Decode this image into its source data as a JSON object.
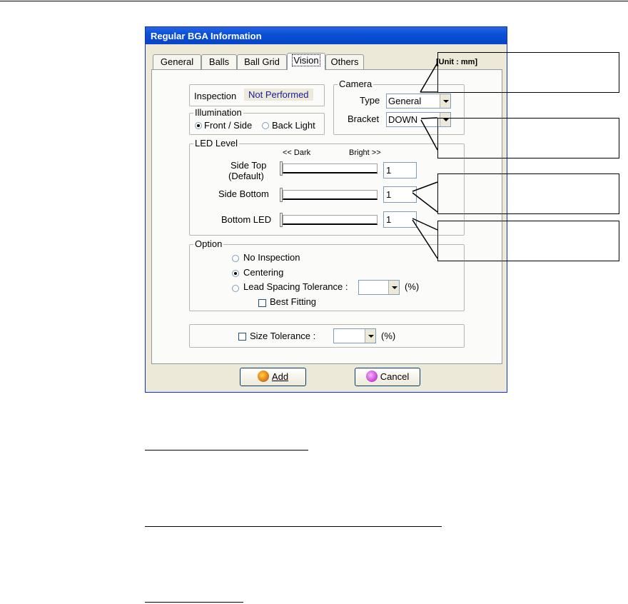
{
  "window": {
    "title": "Regular BGA Information",
    "unit_label": "[Unit : mm]"
  },
  "tabs": [
    {
      "label": "General",
      "active": false
    },
    {
      "label": "Balls",
      "active": false
    },
    {
      "label": "Ball Grid",
      "active": false
    },
    {
      "label": "Vision",
      "active": true
    },
    {
      "label": "Others",
      "active": false
    }
  ],
  "inspection": {
    "label": "Inspection",
    "status": "Not Performed",
    "status_color": "#1a1aa0"
  },
  "illumination": {
    "group_label": "Illumination",
    "options": [
      {
        "label": "Front / Side",
        "selected": true
      },
      {
        "label": "Back Light",
        "selected": false
      }
    ]
  },
  "camera": {
    "group_label": "Camera",
    "type_label": "Type",
    "type_value": "General",
    "bracket_label": "Bracket",
    "bracket_value": "DOWN"
  },
  "led_level": {
    "group_label": "LED Level",
    "dark_label": "<< Dark",
    "bright_label": "Bright >>",
    "rows": [
      {
        "label_line1": "Side Top",
        "label_line2": "(Default)",
        "value": "1",
        "level": 0.0
      },
      {
        "label": "Side Bottom",
        "value": "1",
        "level": 0.0
      },
      {
        "label": "Bottom LED",
        "value": "1",
        "level": 0.0
      }
    ]
  },
  "option": {
    "group_label": "Option",
    "radios": [
      {
        "label": "No Inspection",
        "selected": false
      },
      {
        "label": "Centering",
        "selected": true
      },
      {
        "label": "Lead Spacing Tolerance :",
        "selected": false
      }
    ],
    "lead_spacing_value": "",
    "lead_spacing_unit": "(%)",
    "best_fitting": {
      "label": "Best Fitting",
      "checked": false
    }
  },
  "size_tolerance": {
    "label": "Size Tolerance :",
    "checked": false,
    "value": "",
    "unit": "(%)"
  },
  "buttons": {
    "add": {
      "label": "Add",
      "icon": "add-icon"
    },
    "cancel": {
      "label": "Cancel",
      "icon": "cancel-icon"
    }
  },
  "colors": {
    "titlebar": "#0a52d8",
    "dialog_bg": "#ece9d8",
    "panel_bg": "#fbfbf9"
  }
}
